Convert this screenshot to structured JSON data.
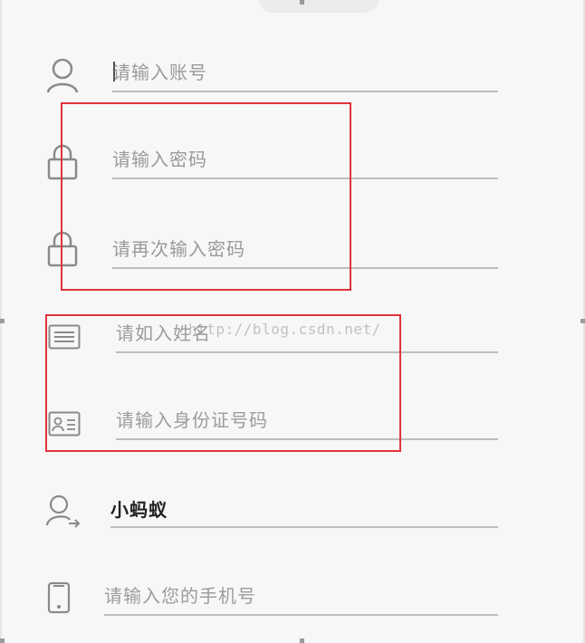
{
  "form": {
    "fields": [
      {
        "name": "account",
        "icon": "user-icon",
        "placeholder": "请输入账号",
        "value": ""
      },
      {
        "name": "password",
        "icon": "lock-icon",
        "placeholder": "请输入密码",
        "value": ""
      },
      {
        "name": "password2",
        "icon": "lock-icon",
        "placeholder": "请再次输入密码",
        "value": ""
      },
      {
        "name": "name",
        "icon": "name-card-icon",
        "placeholder": "请如入姓名",
        "value": ""
      },
      {
        "name": "id_number",
        "icon": "id-card-icon",
        "placeholder": "请输入身份证号码",
        "value": ""
      },
      {
        "name": "referrer",
        "icon": "user-share-icon",
        "placeholder": "",
        "value": "小蚂蚁"
      },
      {
        "name": "phone",
        "icon": "phone-icon",
        "placeholder": "请输入您的手机号",
        "value": ""
      }
    ]
  },
  "annotations": {
    "watermark": "http://blog.csdn.net/",
    "highlight_color": "#e0343a"
  }
}
